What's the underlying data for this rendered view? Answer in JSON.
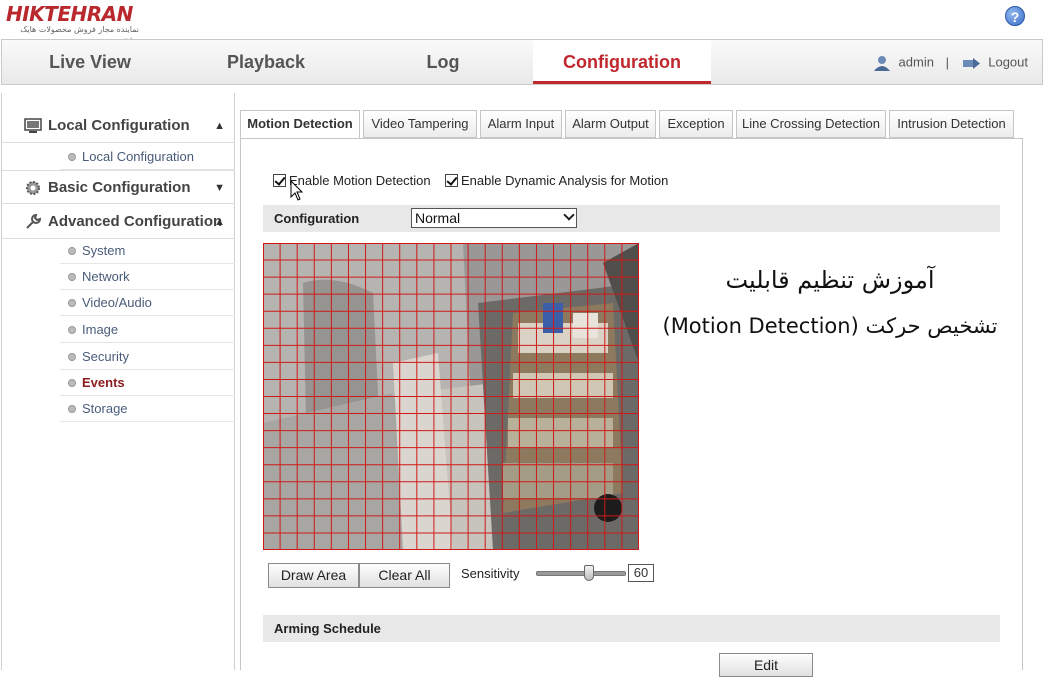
{
  "header": {
    "logo_text": "HIKTEHRAN",
    "logo_sub": "نماینده مجاز فروش محصولات هایک ویژن",
    "help_label": "?"
  },
  "nav": {
    "items": [
      "Live View",
      "Playback",
      "Log",
      "Configuration"
    ],
    "active": "Configuration",
    "user": "admin",
    "separator": "|",
    "logout": "Logout"
  },
  "sidebar": {
    "local": {
      "label": "Local Configuration",
      "items": [
        "Local Configuration"
      ]
    },
    "basic": {
      "label": "Basic Configuration"
    },
    "advanced": {
      "label": "Advanced Configuration",
      "items": [
        "System",
        "Network",
        "Video/Audio",
        "Image",
        "Security",
        "Events",
        "Storage"
      ],
      "active": "Events"
    }
  },
  "tabs": [
    "Motion Detection",
    "Video Tampering",
    "Alarm Input",
    "Alarm Output",
    "Exception",
    "Line Crossing Detection",
    "Intrusion Detection"
  ],
  "active_tab": "Motion Detection",
  "form": {
    "enable_motion": "Enable Motion Detection",
    "enable_dynamic": "Enable Dynamic Analysis for Motion",
    "config_label": "Configuration",
    "config_value": "Normal",
    "draw_area": "Draw Area",
    "clear_all": "Clear All",
    "sensitivity_label": "Sensitivity",
    "sensitivity_value": "60",
    "arming_schedule": "Arming Schedule",
    "edit": "Edit"
  },
  "overlay": {
    "line1": "آموزش تنظیم قابلیت",
    "line2": "تشخیص حرکت (Motion Detection)"
  },
  "colors": {
    "brand": "#c0282d",
    "grid": "#d01818"
  }
}
